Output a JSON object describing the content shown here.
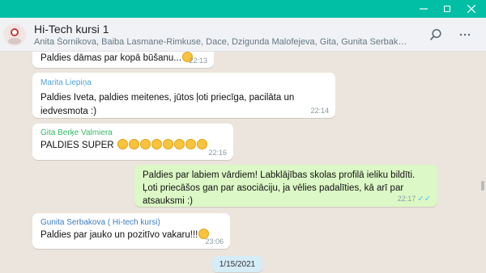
{
  "window": {
    "accent": "#00bfa5"
  },
  "chat": {
    "title": "Hi-Tech kursi 1",
    "members": "Anita Šornikova, Baiba Lasmane-Rimkuse, Dace, Dzigunda Malofejeva, Gita, Gunita Serbakova (, Indra Jakobs…"
  },
  "messages": [
    {
      "text": "Paldies dāmas par kopā būšanu...",
      "time": "22:13"
    },
    {
      "sender": "Marita Liepiņa",
      "sender_color": "#4fa4d8",
      "text": "Paldies Iveta, paldies meitenes, jūtos ļoti priecīga, pacilāta un iedvesmota :)",
      "time": "22:14"
    },
    {
      "sender": "Gita Berķe Valmiera",
      "sender_color": "#35b869",
      "text": "PALDIES SUPER",
      "time": "22:16"
    },
    {
      "text": "Paldies par labiem vārdiem! Labklājības skolas profilā ieliku bildīti. Ļoti priecāšos gan par asociāciju, ja vēlies padalīties, kā arī par atsauksmi :)",
      "time": "22:17",
      "ticks": "✓✓"
    },
    {
      "sender": "Gunita Serbakova ( Hi-tech kursi)",
      "sender_color": "#3c7ec0",
      "text": "Paldies par jauko un pozitīvo vakaru!!!",
      "time": "23:06"
    }
  ],
  "date_separator": "1/15/2021",
  "icons": {
    "search": "search-icon",
    "more": "more-options-icon",
    "tick_color": "#4fc3f7"
  }
}
